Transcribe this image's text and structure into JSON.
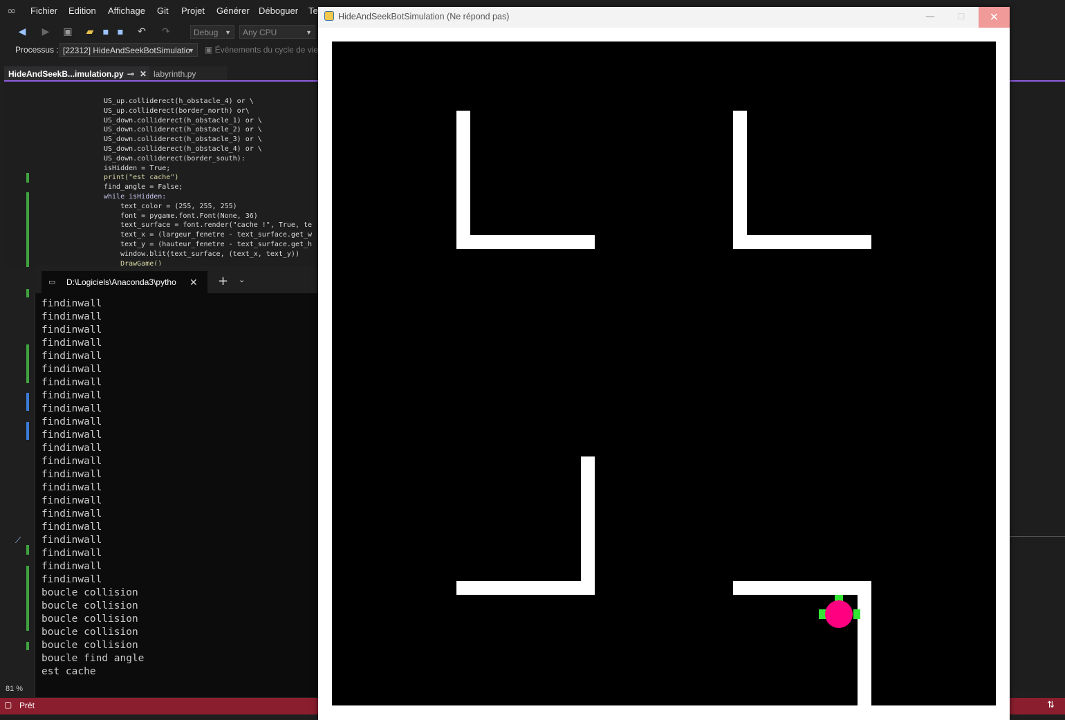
{
  "vs": {
    "menu": [
      "Fichier",
      "Edition",
      "Affichage",
      "Git",
      "Projet",
      "Générer",
      "Déboguer",
      "Tes"
    ],
    "config": "Debug",
    "platform": "Any CPU",
    "process_label": "Processus :",
    "process_value": "[22312] HideAndSeekBotSimulatio",
    "lifecycle_label": "Événements du cycle de vie",
    "tabs": [
      "HideAndSeekB...imulation.py",
      "labyrinth.py"
    ],
    "zoom": "81 %",
    "status": "Prêt"
  },
  "code_lines": [
    "US_up.colliderect(h_obstacle_4) or \\",
    "US_up.colliderect(border_north) or\\",
    "US_down.colliderect(h_obstacle_1) or \\",
    "US_down.colliderect(h_obstacle_2) or \\",
    "US_down.colliderect(h_obstacle_3) or \\",
    "US_down.colliderect(h_obstacle_4) or \\",
    "US_down.colliderect(border_south):",
    "isHidden = True;",
    "print(\"est cache\")",
    "find_angle = False;",
    "while isHidden:",
    "    text_color = (255, 255, 255)",
    "    font = pygame.font.Font(None, 36)",
    "    text_surface = font.render(\"cache !\", True, te",
    "    text_x = (largeur_fenetre - text_surface.get_w",
    "    text_y = (hauteur_fenetre - text_surface.get_h",
    "    window.blit(text_surface, (text_x, text_y))",
    "    DrawGame()"
  ],
  "terminal": {
    "tab_title": "D:\\Logiciels\\Anaconda3\\pytho",
    "lines": [
      "findinwall",
      "findinwall",
      "findinwall",
      "findinwall",
      "findinwall",
      "findinwall",
      "findinwall",
      "findinwall",
      "findinwall",
      "findinwall",
      "findinwall",
      "findinwall",
      "findinwall",
      "findinwall",
      "findinwall",
      "findinwall",
      "findinwall",
      "findinwall",
      "findinwall",
      "findinwall",
      "findinwall",
      "findinwall",
      "boucle collision",
      "boucle collision",
      "boucle collision",
      "boucle collision",
      "boucle collision",
      "boucle find angle",
      "est cache"
    ]
  },
  "pygame": {
    "title": "HideAndSeekBotSimulation (Ne répond pas)",
    "bot_color": "#ff0080",
    "sensor_color": "#33e633"
  }
}
